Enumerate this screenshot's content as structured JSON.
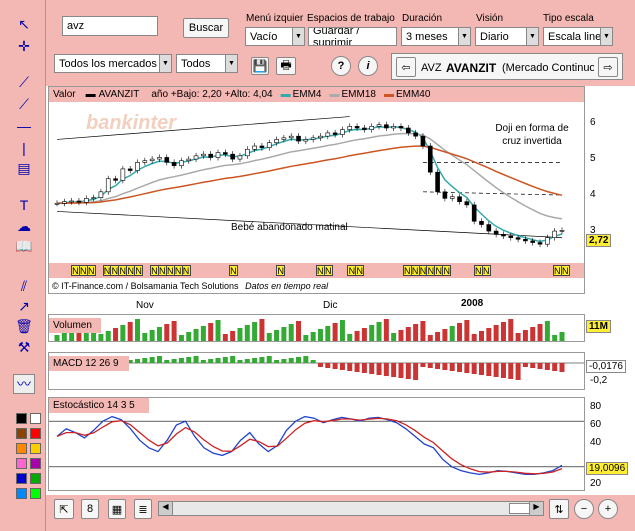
{
  "search": {
    "value": "avz",
    "button": "Buscar"
  },
  "market_filter": {
    "selected": "Todos los mercados"
  },
  "type_filter": {
    "selected": "Todos"
  },
  "menu_izq": {
    "label": "Menú izquier",
    "selected": "Vacío"
  },
  "workspaces": {
    "label": "Espacios de trabajo",
    "selected": "Guardar / suprimir"
  },
  "duration": {
    "label": "Duración",
    "selected": "3 meses"
  },
  "vision": {
    "label": "Visión",
    "selected": "Diario"
  },
  "scale": {
    "label": "Tipo escala",
    "selected": "Escala lineal"
  },
  "instrument": {
    "code": "AVZ",
    "name": "AVANZIT",
    "market": "(Mercado Continuo)"
  },
  "price_panel": {
    "legend_prefix": "Valor",
    "series_label": "AVANZIT",
    "stats": "año +Bajo: 2,20 +Alto: 4,04",
    "ma1": "EMM4",
    "ma2": "EMM18",
    "ma3": "EMM40",
    "last_price": "2,72",
    "annotation_doji": "Doji en forma de cruz invertida",
    "annotation_baby": "Bebé abandonado matinal",
    "watermark": "bankinter",
    "credits": "© IT-Finance.com / Bolsamania Tech Solutions",
    "realtime": "Datos en tiempo real",
    "y_ticks": [
      "6",
      "5",
      "4",
      "3"
    ]
  },
  "time_axis": {
    "labels": [
      "Nov",
      "Dic",
      "2008"
    ]
  },
  "volume_panel": {
    "label": "Volumen",
    "value": "11M"
  },
  "macd_panel": {
    "label": "MACD 12 26 9",
    "value": "-0,0176",
    "tick": "-0,2"
  },
  "stoch_panel": {
    "label": "Estocástico 14 3 5",
    "value": "19,0096",
    "ticks": [
      "80",
      "60",
      "40",
      "20"
    ]
  },
  "news_markers": "N",
  "colors": {
    "toolbar": "#f4b8b4",
    "price_line": "#000000",
    "ema4": "#33aaaa",
    "ema18": "#aaaaaa",
    "ema40": "#cc5522",
    "up_bar": "#33aa33",
    "down_bar": "#cc3333",
    "stoch_k": "#2244cc",
    "stoch_d": "#cc2222",
    "last_tag": "#ffee33",
    "news_bg": "#ffee33"
  }
}
